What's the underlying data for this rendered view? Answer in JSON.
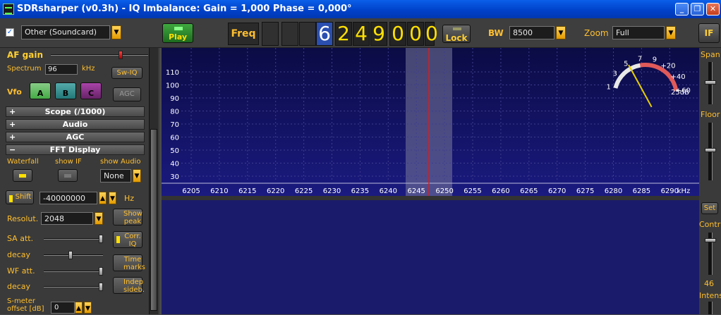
{
  "window": {
    "title": "SDRsharper (v0.3h) - IQ Imbalance: Gain = 1,000 Phase = 0,000°",
    "minimize": "_",
    "restore": "❐",
    "close": "✕"
  },
  "toolbar": {
    "source_checked": "✓",
    "source": "Other (Soundcard)",
    "play_label": "Play",
    "freq_label": "Freq",
    "frequency_digits": [
      "6",
      "2",
      "4",
      "9",
      "0",
      "0",
      "0"
    ],
    "lock_label": "Lock",
    "bw_label": "BW",
    "bw_value": "8500",
    "zoom_label": "Zoom",
    "zoom_value": "Full",
    "if_label": "IF"
  },
  "left_panel": {
    "af_gain_label": "AF gain",
    "af_gain_level": 0.73,
    "spectrum_label": "Spectrum",
    "spectrum_value": "96",
    "spectrum_unit": "kHz",
    "swiq_label": "Sw-IQ",
    "vfo_label": "Vfo",
    "vfo_a": "A",
    "vfo_b": "B",
    "vfo_c": "C",
    "agc_btn": "AGC",
    "sections": [
      {
        "sign": "+",
        "label": "Scope (/1000)"
      },
      {
        "sign": "+",
        "label": "Audio"
      },
      {
        "sign": "+",
        "label": "AGC"
      },
      {
        "sign": "−",
        "label": "FFT Display"
      }
    ],
    "waterfall_label": "Waterfall",
    "show_if_label": "show IF",
    "show_audio_label": "show Audio",
    "show_audio_value": "None",
    "shift_label": "Shift",
    "shift_value": "-40000000",
    "shift_unit": "Hz",
    "resolution_label": "Resolut.",
    "resolution_value": "2048",
    "show_peak": "Show peak",
    "sa_att_label": "SA att.",
    "corr_iq": "Corr. IQ",
    "decay_label": "decay",
    "time_marks": "Time marks",
    "wf_att_label": "WF att.",
    "decay2_label": "decay",
    "indep_sideb": "Indep sideb.",
    "smeter_offset_label_1": "S-meter",
    "smeter_offset_label_2": "offset [dB]",
    "smeter_offset_value": "0",
    "sa_att_level": 1.0,
    "decay_level": 0.45,
    "wf_att_level": 1.0,
    "decay2_level": 1.0
  },
  "spectrum": {
    "y_ticks": [
      "110",
      "100",
      "90",
      "80",
      "70",
      "60",
      "50",
      "40",
      "30"
    ],
    "x_ticks": [
      "6205",
      "6210",
      "6215",
      "6220",
      "6225",
      "6230",
      "6235",
      "6240",
      "6245",
      "6250",
      "6255",
      "6260",
      "6265",
      "6270",
      "6275",
      "6280",
      "6285",
      "6290"
    ],
    "x_unit": "kHz",
    "smeter_scale": [
      "1",
      "3",
      "5",
      "7",
      "9",
      "+20",
      "+40",
      "+60"
    ],
    "smeter_reading": "25dB",
    "colors": {
      "background": "#13136a",
      "grid": "#3e3e8e",
      "filter_band": "#7a7a9a",
      "carrier_line": "#d02020",
      "smeter_needle": "#e8d000"
    }
  },
  "right_panel": {
    "span_label": "Span",
    "floor_label": "Floor",
    "set_label": "Set",
    "contr_label": "Contr",
    "intens_value": "46",
    "intens_label": "Intens"
  }
}
